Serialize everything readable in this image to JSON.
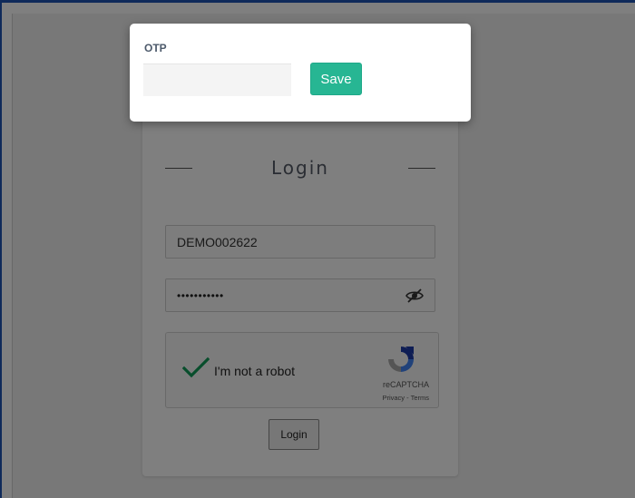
{
  "login": {
    "title": "Login",
    "username_value": "DEMO002622",
    "password_mask": "•••••••••••",
    "recaptcha": {
      "label": "I'm not a robot",
      "brand": "reCAPTCHA",
      "links": "Privacy - Terms",
      "check_color": "#109d58"
    },
    "login_button": "Login"
  },
  "otp_modal": {
    "label": "OTP",
    "input_value": "",
    "save_label": "Save",
    "accent": "#27b693"
  },
  "icons": [
    "eye-slash-icon",
    "checkmark-icon",
    "recaptcha-logo-icon"
  ]
}
